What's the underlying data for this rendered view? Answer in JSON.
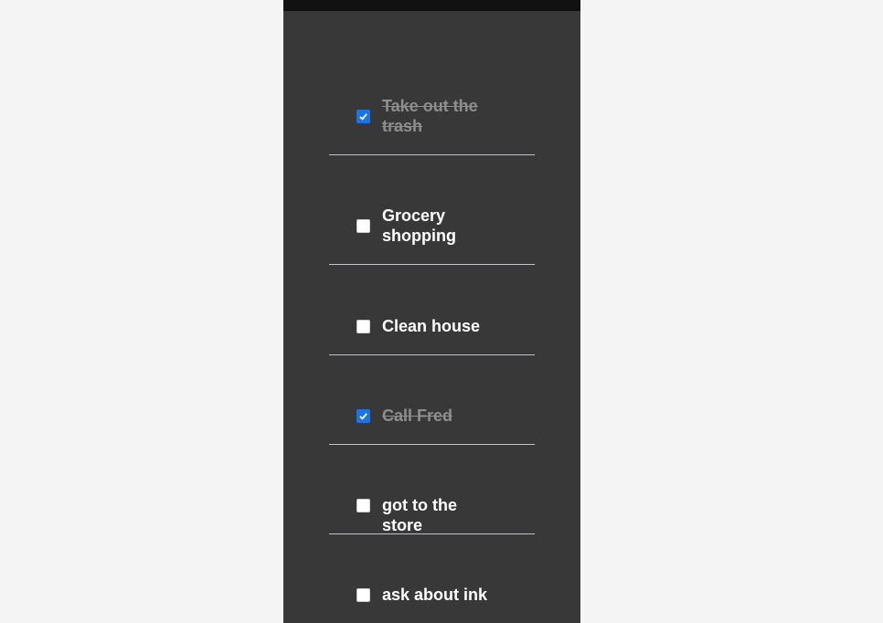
{
  "todos": [
    {
      "text": "Take out the trash",
      "done": true
    },
    {
      "text": "Grocery shopping",
      "done": false
    },
    {
      "text": "Clean house",
      "done": false
    },
    {
      "text": "Call Fred",
      "done": true
    },
    {
      "text": "got to the store",
      "done": false
    },
    {
      "text": "ask about ink",
      "done": false
    }
  ],
  "colors": {
    "panel": "#383838",
    "header": "#111111",
    "checked": "#1a73e8",
    "done_text": "#8e8e8e"
  }
}
